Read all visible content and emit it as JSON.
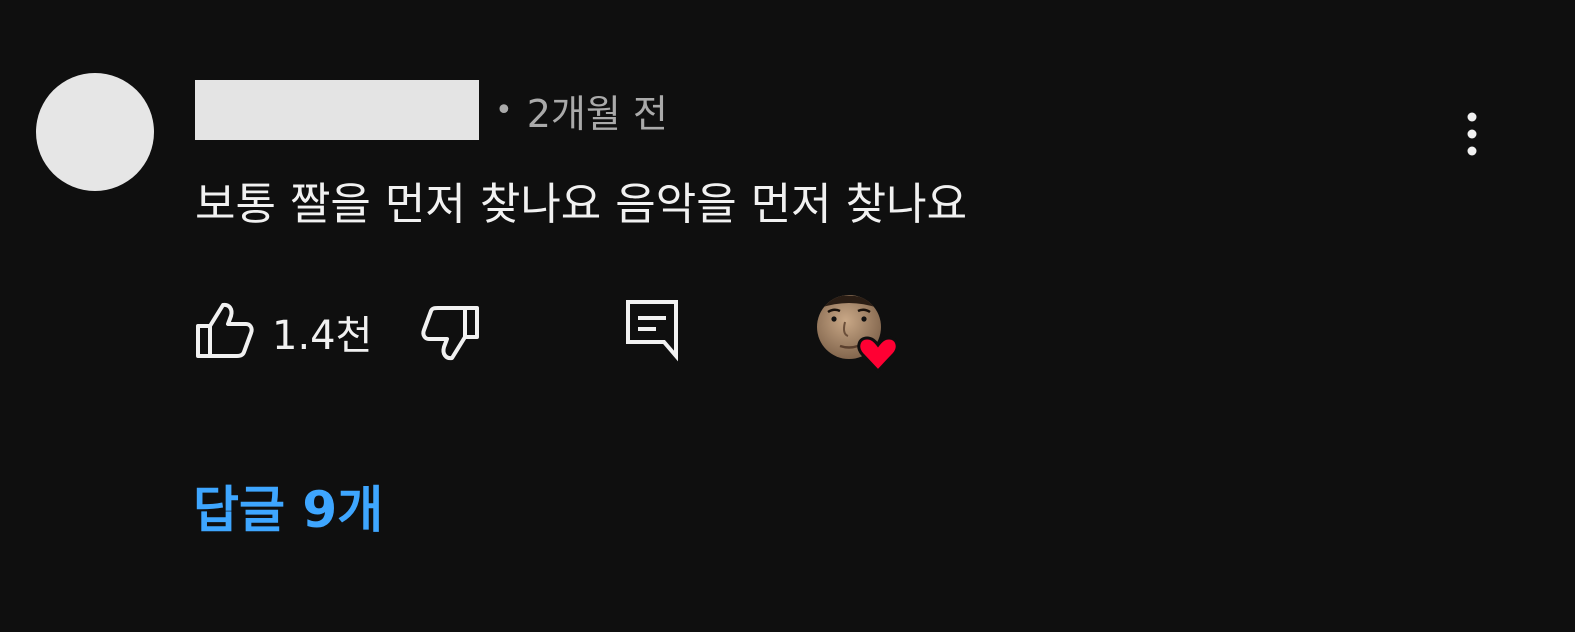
{
  "comment": {
    "author_name": "",
    "separator": "•",
    "timestamp": "2개월 전",
    "text": "보통 짤을 먼저 찾나요 음악을 먼저 찾나요",
    "like_count": "1.4천",
    "replies_label": "답글 9개"
  },
  "icons": {
    "more": "vertical-ellipsis-icon",
    "like": "thumbs-up-icon",
    "dislike": "thumbs-down-icon",
    "reply": "reply-comment-icon",
    "creator_heart": "creator-heart-icon"
  },
  "colors": {
    "background": "#0f0f0f",
    "text_primary": "#f1f1f1",
    "text_secondary": "#aaaaaa",
    "link_blue": "#3ea6ff",
    "heart_red": "#ff0033",
    "avatar_placeholder": "#e6e6e6"
  }
}
